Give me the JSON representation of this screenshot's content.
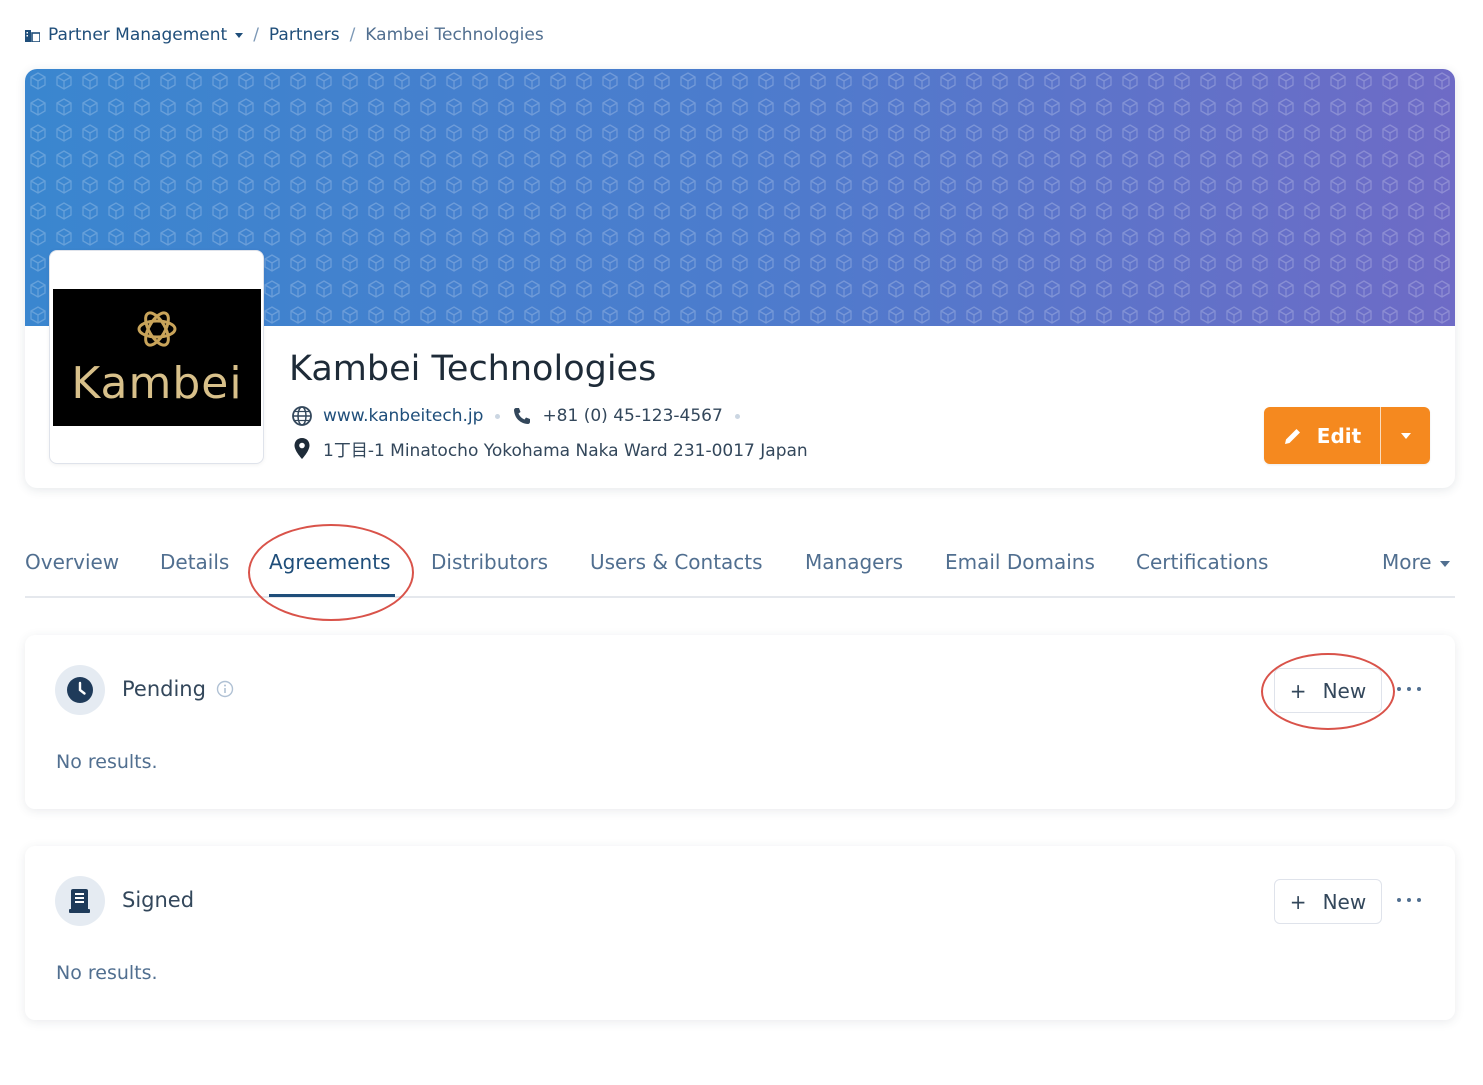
{
  "breadcrumb": {
    "root": "Partner Management",
    "parent": "Partners",
    "current": "Kambei Technologies",
    "separator": "/"
  },
  "company": {
    "name": "Kambei Technologies",
    "logo_text": "Kambei",
    "website": "www.kanbeitech.jp",
    "phone": "+81 (0) 45-123-4567",
    "address": "1丁目-1 Minatocho Yokohama Naka Ward 231-0017 Japan"
  },
  "actions": {
    "edit_label": "Edit"
  },
  "tabs": {
    "overview": "Overview",
    "details": "Details",
    "agreements": "Agreements",
    "distributors": "Distributors",
    "users_contacts": "Users & Contacts",
    "managers": "Managers",
    "email_domains": "Email Domains",
    "certifications": "Certifications",
    "more": "More",
    "active": "Agreements"
  },
  "sections": {
    "pending": {
      "title": "Pending",
      "empty": "No results.",
      "new_label": "New"
    },
    "signed": {
      "title": "Signed",
      "empty": "No results.",
      "new_label": "New"
    }
  },
  "colors": {
    "accent_orange": "#f5891f",
    "link_blue": "#1f4e7a",
    "annotation_red": "#d9534a"
  }
}
